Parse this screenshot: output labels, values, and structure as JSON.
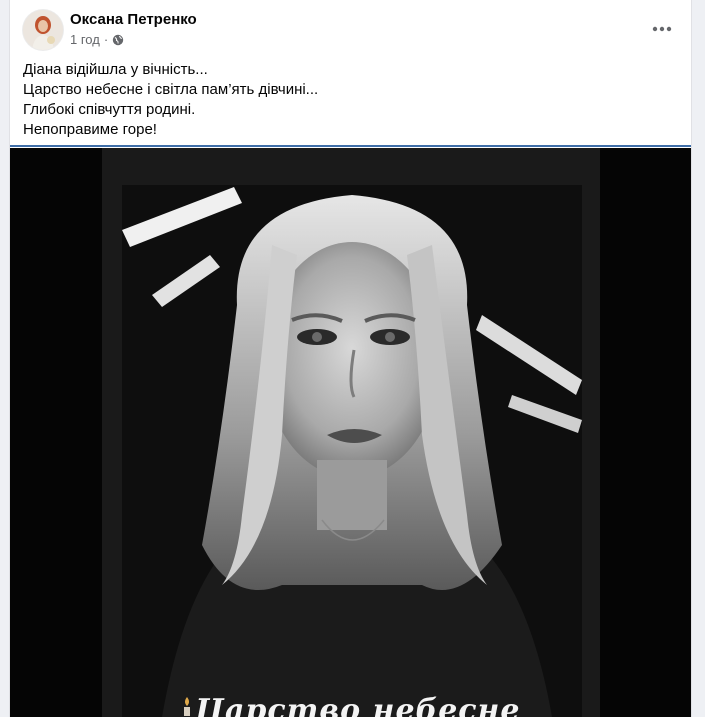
{
  "post": {
    "author": "Оксана Петренко",
    "time": "1 год",
    "separator": "·",
    "privacy_icon": "globe-icon",
    "more_icon": "more-dots-icon",
    "lines": [
      "Діана відійшла у вічність...",
      "Царство небесне і світла пам’ять дівчині...",
      "Глибокі співчуття родині.",
      "Непоправиме горе!"
    ]
  },
  "photo": {
    "overlay_text": "Царство небесне",
    "style": "black-and-white memorial portrait"
  },
  "colors": {
    "card_bg": "#ffffff",
    "page_bg": "#eef0f4",
    "name": "#050505",
    "meta": "#65676b",
    "divider": "#3f6ea8"
  }
}
